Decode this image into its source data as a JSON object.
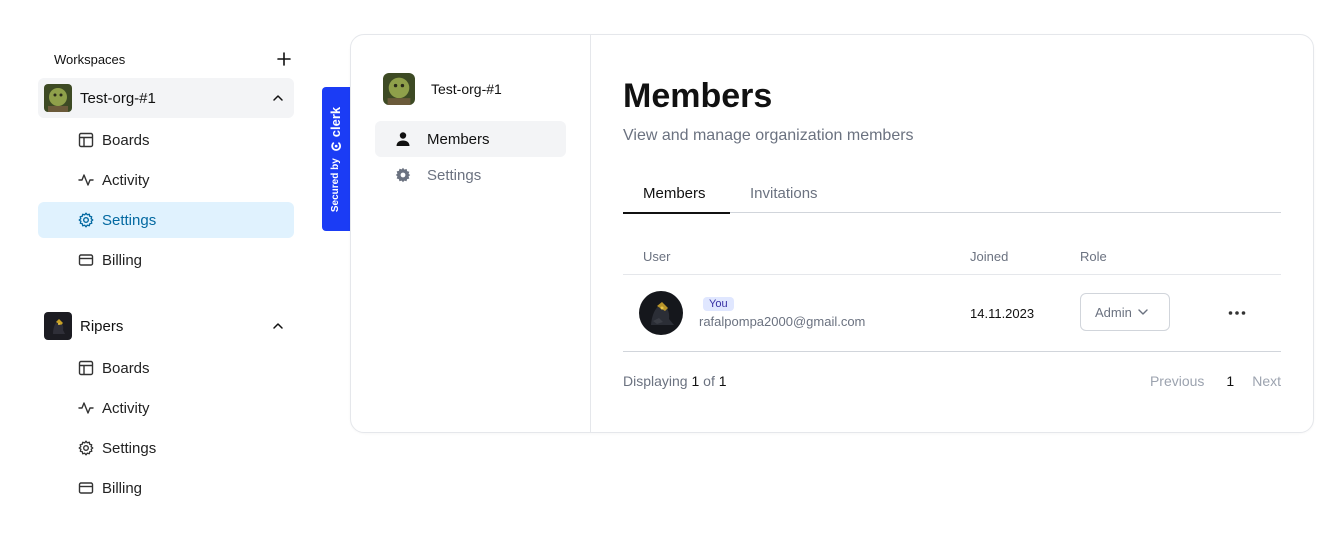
{
  "sidebar": {
    "section_title": "Workspaces",
    "add_icon": "plus-icon",
    "orgs": [
      {
        "name": "Test-org-#1",
        "expanded": true,
        "items": [
          {
            "label": "Boards",
            "icon": "layout-icon"
          },
          {
            "label": "Activity",
            "icon": "activity-icon"
          },
          {
            "label": "Settings",
            "icon": "gear-icon",
            "active": true
          },
          {
            "label": "Billing",
            "icon": "credit-card-icon"
          }
        ]
      },
      {
        "name": "Ripers",
        "expanded": true,
        "items": [
          {
            "label": "Boards",
            "icon": "layout-icon"
          },
          {
            "label": "Activity",
            "icon": "activity-icon"
          },
          {
            "label": "Settings",
            "icon": "gear-icon"
          },
          {
            "label": "Billing",
            "icon": "credit-card-icon"
          }
        ]
      }
    ]
  },
  "clerk_badge": {
    "secured_by": "Secured by",
    "brand": "clerk",
    "color": "#1b3cf5"
  },
  "org_panel": {
    "org_name": "Test-org-#1",
    "nav": [
      {
        "label": "Members",
        "icon": "user-icon",
        "active": true
      },
      {
        "label": "Settings",
        "icon": "gear-icon"
      }
    ]
  },
  "members": {
    "title": "Members",
    "subtitle": "View and manage organization members",
    "tabs": [
      {
        "label": "Members",
        "active": true
      },
      {
        "label": "Invitations"
      }
    ],
    "columns": {
      "user": "User",
      "joined": "Joined",
      "role": "Role"
    },
    "rows": [
      {
        "badge": "You",
        "email": "rafalpompa2000@gmail.com",
        "joined": "14.11.2023",
        "role": "Admin"
      }
    ],
    "footer": {
      "display_prefix": "Displaying",
      "current": "1",
      "of": "of",
      "total": "1",
      "previous": "Previous",
      "page": "1",
      "next": "Next"
    }
  },
  "colors": {
    "active_nav_bg": "#e0f2fe",
    "active_nav_text": "#0369a1",
    "badge_bg": "#e0e7ff",
    "badge_text": "#3730a3"
  }
}
